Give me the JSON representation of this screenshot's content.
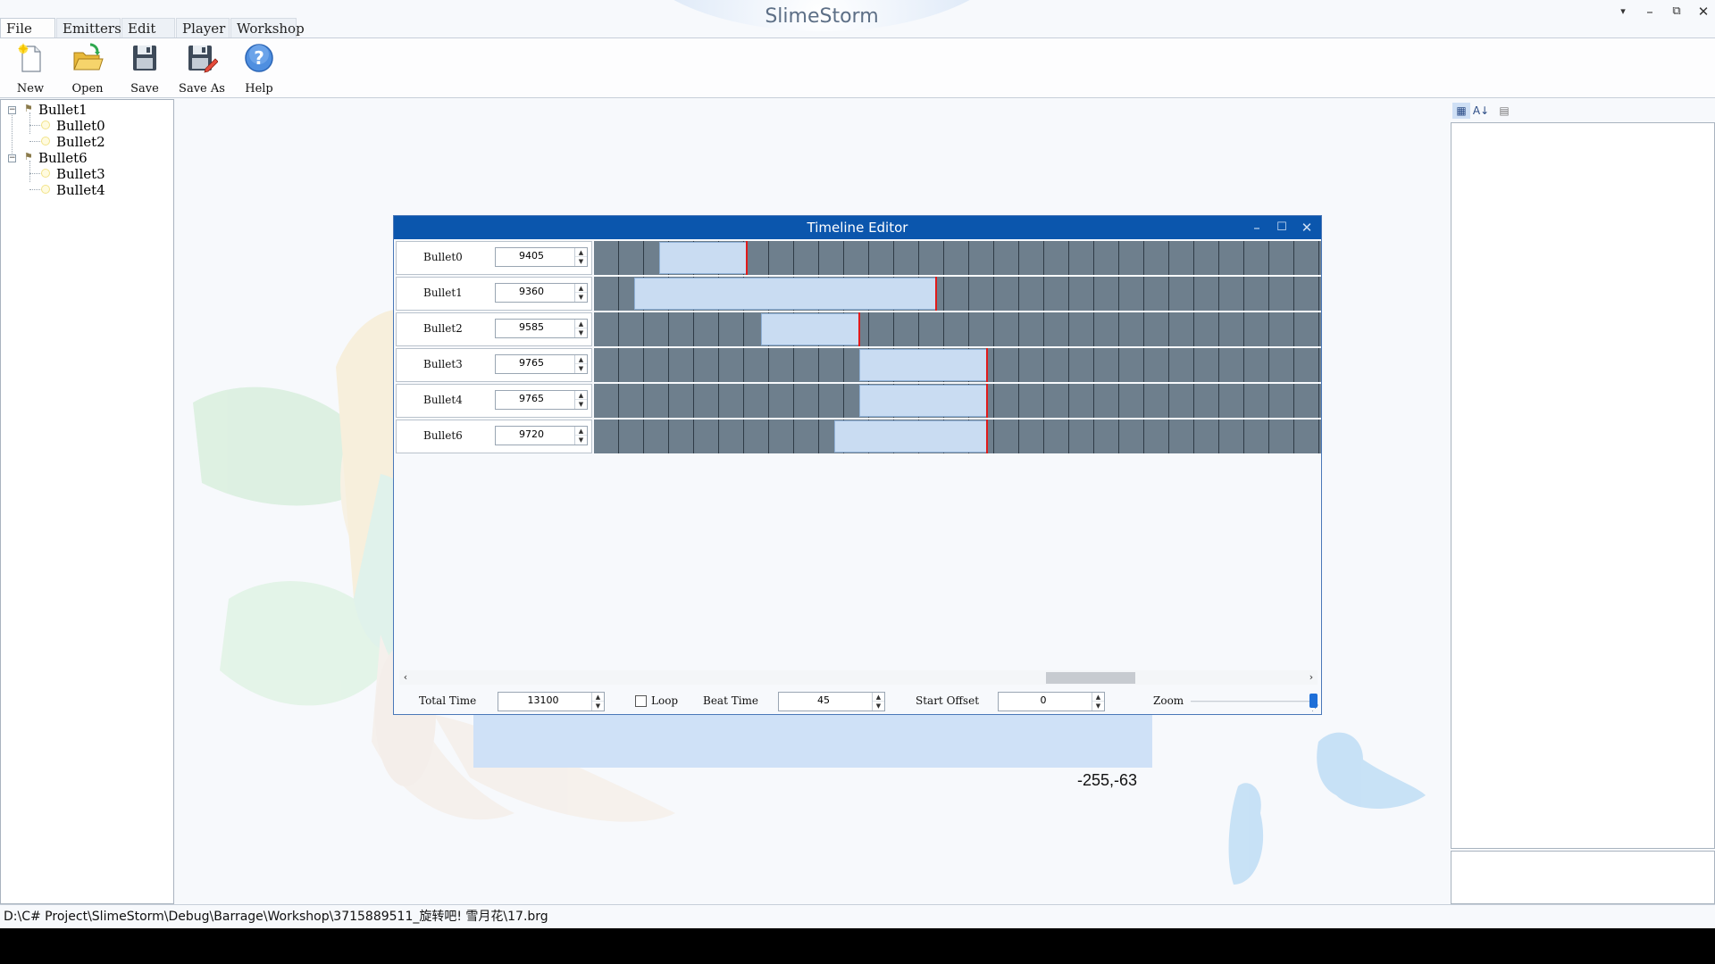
{
  "app": {
    "title": "SlimeStorm"
  },
  "window_controls": {
    "menu_glyph": "▾",
    "minimize_glyph": "–",
    "restore_glyph": "⧉",
    "close_glyph": "✕"
  },
  "menu_tabs": [
    {
      "label": "File",
      "active": true
    },
    {
      "label": "Emitters",
      "active": false
    },
    {
      "label": "Edit",
      "active": false
    },
    {
      "label": "Player",
      "active": false
    },
    {
      "label": "Workshop",
      "active": false
    }
  ],
  "ribbon": {
    "buttons": [
      {
        "label": "New",
        "icon": "new-file-icon"
      },
      {
        "label": "Open",
        "icon": "open-folder-icon"
      },
      {
        "label": "Save",
        "icon": "save-disk-icon"
      },
      {
        "label": "Save As",
        "icon": "save-as-disk-icon"
      },
      {
        "label": "Help",
        "icon": "help-icon"
      }
    ]
  },
  "tree": {
    "groups": [
      {
        "label": "Bullet1",
        "expand_glyph": "−",
        "children": [
          "Bullet0",
          "Bullet2"
        ]
      },
      {
        "label": "Bullet6",
        "expand_glyph": "−",
        "children": [
          "Bullet3",
          "Bullet4"
        ]
      }
    ]
  },
  "property_toolbar": {
    "icons": [
      "categorized-icon",
      "alphabetical-sort-icon",
      "property-pages-icon"
    ]
  },
  "timeline": {
    "title": "Timeline Editor",
    "controls": {
      "minimize_glyph": "–",
      "maximize_glyph": "☐",
      "close_glyph": "✕"
    },
    "rows": [
      {
        "name": "Bullet0",
        "value": "9405",
        "start": 0.09,
        "end": 0.21
      },
      {
        "name": "Bullet1",
        "value": "9360",
        "start": 0.055,
        "end": 0.47
      },
      {
        "name": "Bullet2",
        "value": "9585",
        "start": 0.23,
        "end": 0.365
      },
      {
        "name": "Bullet3",
        "value": "9765",
        "start": 0.365,
        "end": 0.54
      },
      {
        "name": "Bullet4",
        "value": "9765",
        "start": 0.365,
        "end": 0.54
      },
      {
        "name": "Bullet6",
        "value": "9720",
        "start": 0.33,
        "end": 0.54
      }
    ],
    "scroll": {
      "left_glyph": "‹",
      "right_glyph": "›"
    },
    "footer": {
      "total_time_label": "Total Time",
      "total_time": "13100",
      "loop_label": "Loop",
      "loop_checked": false,
      "beat_time_label": "Beat Time",
      "beat_time": "45",
      "start_offset_label": "Start Offset",
      "start_offset": "0",
      "zoom_label": "Zoom",
      "zoom_level": 0.98
    },
    "spin_up_glyph": "▲",
    "spin_down_glyph": "▼",
    "grip_glyph": "⋰"
  },
  "canvas": {
    "coordinate_readout": "-255,-63"
  },
  "status": {
    "path": "D:\\C# Project\\SlimeStorm\\Debug\\Barrage\\Workshop\\3715889511_旋转吧! 雪月花\\17.brg"
  }
}
